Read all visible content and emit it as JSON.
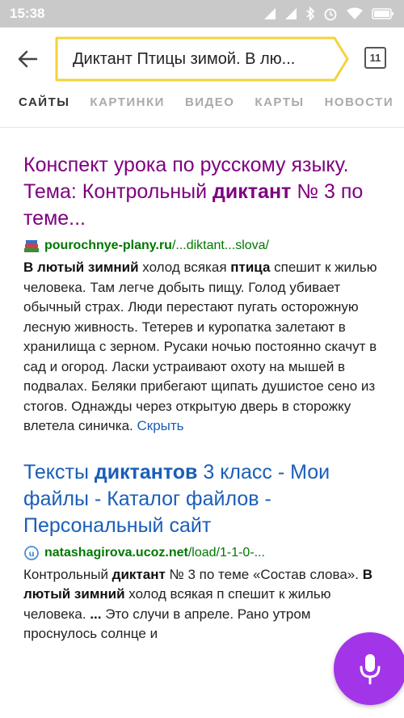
{
  "status": {
    "time": "15:38",
    "battery_label": ""
  },
  "search": {
    "query": "Диктант Птицы зимой. В лю...",
    "tabs_count": "11"
  },
  "tabs": [
    "САЙТЫ",
    "КАРТИНКИ",
    "ВИДЕО",
    "КАРТЫ",
    "НОВОСТИ"
  ],
  "results": [
    {
      "title_pre": "Конспект урока по русскому языку. Тема: Контрольный ",
      "title_bold": "диктант",
      "title_post": " № 3 по теме...",
      "domain": "pourochnye-plany.ru",
      "path": "/...diktant...slova/",
      "snippet_b1": "В лютый зимний",
      "snippet_t1": " холод всякая ",
      "snippet_b2": "птица",
      "snippet_t2": " спешит к жилью человека. Там легче добыть пищу. Голод убивает обычный страх. Люди перестают пугать осторожную лесную живность. Тетерев и куропатка залетают в хранилища с зерном. Русаки ночью постоянно скачут в сад и огород. Ласки устраивают охоту на мышей в подвалах. Беляки прибегают щипать душистое сено из стогов. Однажды через открытую дверь в сторожку влетела синичка. ",
      "hide_label": "Скрыть"
    },
    {
      "title_pre": "Тексты ",
      "title_bold": "диктантов",
      "title_post": " 3 класс - Мои файлы - Каталог файлов - Персональный сайт",
      "domain": "natashagirova.ucoz.net",
      "path": "/load/1-1-0-...",
      "snippet_t0": "Контрольный ",
      "snippet_b0": "диктант",
      "snippet_t1": " № 3 по теме «Состав слова». ",
      "snippet_b1": "В лютый зимний",
      "snippet_t2": " холод всякая п спешит к жилью человека. ",
      "snippet_b2": "...",
      "snippet_t3": " Это случи в апреле. Рано утром проснулось солнце и"
    }
  ],
  "colors": {
    "visited_title": "#800080",
    "link": "#1a5eb8",
    "url": "#007700",
    "search_border": "#f5d23b",
    "mic": "#a235e8"
  }
}
